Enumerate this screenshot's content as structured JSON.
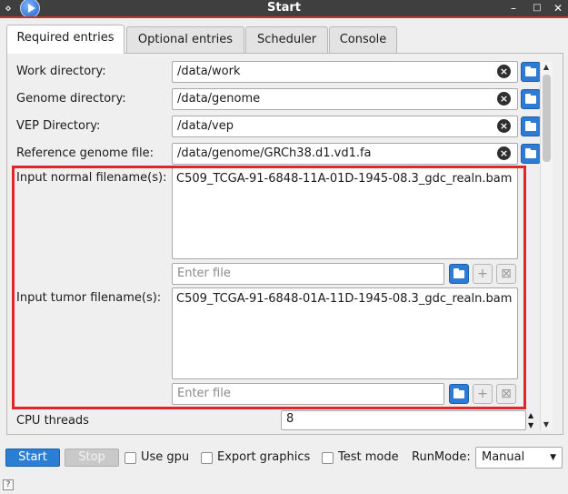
{
  "window": {
    "title": "Start"
  },
  "tabs": [
    {
      "label": "Required entries"
    },
    {
      "label": "Optional entries"
    },
    {
      "label": "Scheduler"
    },
    {
      "label": "Console"
    }
  ],
  "fields": {
    "work_dir": {
      "label": "Work directory:",
      "value": "/data/work"
    },
    "genome_dir": {
      "label": "Genome directory:",
      "value": "/data/genome"
    },
    "vep_dir": {
      "label": "VEP Directory:",
      "value": "/data/vep"
    },
    "ref_genome": {
      "label": "Reference genome file:",
      "value": "/data/genome/GRCh38.d1.vd1.fa"
    }
  },
  "normal": {
    "label": "Input normal filename(s):",
    "files": [
      "C509_TCGA-91-6848-11A-01D-1945-08.3_gdc_realn.bam"
    ],
    "placeholder": "Enter file"
  },
  "tumor": {
    "label": "Input tumor filename(s):",
    "files": [
      "C509_TCGA-91-6848-01A-11D-1945-08.3_gdc_realn.bam"
    ],
    "placeholder": "Enter file"
  },
  "cpu": {
    "label": "CPU threads",
    "value": "8"
  },
  "bottom": {
    "start": "Start",
    "stop": "Stop",
    "use_gpu": "Use gpu",
    "export_graphics": "Export graphics",
    "test_mode": "Test mode",
    "runmode_label": "RunMode:",
    "runmode_value": "Manual"
  },
  "status": {
    "help": "?"
  },
  "colors": {
    "accent": "#2a7fd4",
    "highlight": "#e2242b",
    "titlebar": "#3f3f3f"
  }
}
